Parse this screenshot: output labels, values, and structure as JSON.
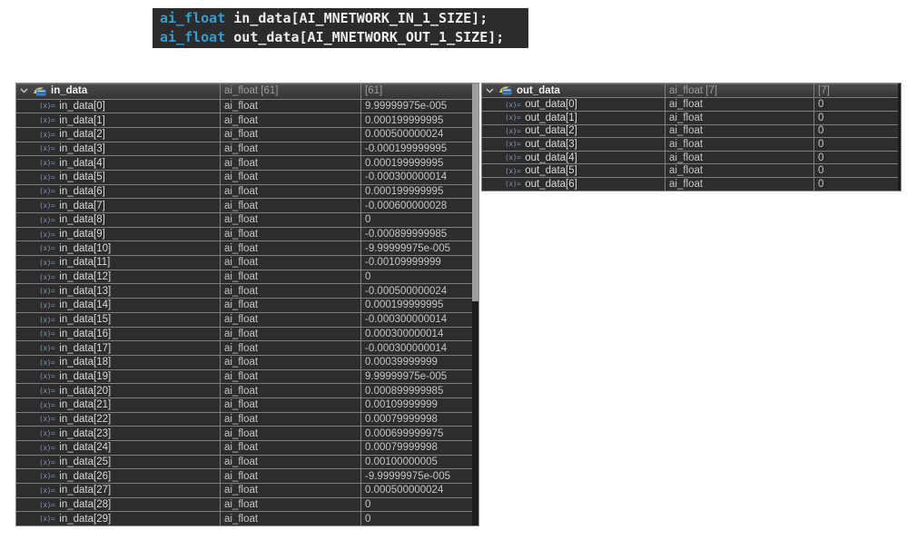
{
  "code": {
    "lines": [
      {
        "keyword": "ai_float",
        "rest": " in_data[AI_MNETWORK_IN_1_SIZE];"
      },
      {
        "keyword": "ai_float",
        "rest": " out_data[AI_MNETWORK_OUT_1_SIZE];"
      }
    ],
    "keyword_color": "#2f9fd6",
    "background_color": "#2b2b2b"
  },
  "icons": {
    "chevron_expanded": "chevron-down",
    "variable_glyph": "(x)=",
    "array_icon_blue": "#3f7fc1",
    "array_icon_yellow": "#e8c44a"
  },
  "tables": [
    {
      "id": "in_data",
      "header": {
        "name": "in_data",
        "type": "ai_float [61]",
        "value": "[61]"
      },
      "rows": [
        {
          "name": "in_data[0]",
          "type": "ai_float",
          "value": "9.99999975e-005"
        },
        {
          "name": "in_data[1]",
          "type": "ai_float",
          "value": "0.000199999995"
        },
        {
          "name": "in_data[2]",
          "type": "ai_float",
          "value": "0.000500000024"
        },
        {
          "name": "in_data[3]",
          "type": "ai_float",
          "value": "-0.000199999995"
        },
        {
          "name": "in_data[4]",
          "type": "ai_float",
          "value": "0.000199999995"
        },
        {
          "name": "in_data[5]",
          "type": "ai_float",
          "value": "-0.000300000014"
        },
        {
          "name": "in_data[6]",
          "type": "ai_float",
          "value": "0.000199999995"
        },
        {
          "name": "in_data[7]",
          "type": "ai_float",
          "value": "-0.000600000028"
        },
        {
          "name": "in_data[8]",
          "type": "ai_float",
          "value": "0"
        },
        {
          "name": "in_data[9]",
          "type": "ai_float",
          "value": "-0.000899999985"
        },
        {
          "name": "in_data[10]",
          "type": "ai_float",
          "value": "-9.99999975e-005"
        },
        {
          "name": "in_data[11]",
          "type": "ai_float",
          "value": "-0.00109999999"
        },
        {
          "name": "in_data[12]",
          "type": "ai_float",
          "value": "0"
        },
        {
          "name": "in_data[13]",
          "type": "ai_float",
          "value": "-0.000500000024"
        },
        {
          "name": "in_data[14]",
          "type": "ai_float",
          "value": "0.000199999995"
        },
        {
          "name": "in_data[15]",
          "type": "ai_float",
          "value": "-0.000300000014"
        },
        {
          "name": "in_data[16]",
          "type": "ai_float",
          "value": "0.000300000014"
        },
        {
          "name": "in_data[17]",
          "type": "ai_float",
          "value": "-0.000300000014"
        },
        {
          "name": "in_data[18]",
          "type": "ai_float",
          "value": "0.00039999999"
        },
        {
          "name": "in_data[19]",
          "type": "ai_float",
          "value": "9.99999975e-005"
        },
        {
          "name": "in_data[20]",
          "type": "ai_float",
          "value": "0.000899999985"
        },
        {
          "name": "in_data[21]",
          "type": "ai_float",
          "value": "0.00109999999"
        },
        {
          "name": "in_data[22]",
          "type": "ai_float",
          "value": "0.00079999998"
        },
        {
          "name": "in_data[23]",
          "type": "ai_float",
          "value": "0.000699999975"
        },
        {
          "name": "in_data[24]",
          "type": "ai_float",
          "value": "0.00079999998"
        },
        {
          "name": "in_data[25]",
          "type": "ai_float",
          "value": "0.00100000005"
        },
        {
          "name": "in_data[26]",
          "type": "ai_float",
          "value": "-9.99999975e-005"
        },
        {
          "name": "in_data[27]",
          "type": "ai_float",
          "value": "0.000500000024"
        },
        {
          "name": "in_data[28]",
          "type": "ai_float",
          "value": "0"
        },
        {
          "name": "in_data[29]",
          "type": "ai_float",
          "value": "0"
        }
      ]
    },
    {
      "id": "out_data",
      "header": {
        "name": "out_data",
        "type": "ai_float [7]",
        "value": "[7]"
      },
      "rows": [
        {
          "name": "out_data[0]",
          "type": "ai_float",
          "value": "0"
        },
        {
          "name": "out_data[1]",
          "type": "ai_float",
          "value": "0"
        },
        {
          "name": "out_data[2]",
          "type": "ai_float",
          "value": "0"
        },
        {
          "name": "out_data[3]",
          "type": "ai_float",
          "value": "0"
        },
        {
          "name": "out_data[4]",
          "type": "ai_float",
          "value": "0"
        },
        {
          "name": "out_data[5]",
          "type": "ai_float",
          "value": "0"
        },
        {
          "name": "out_data[6]",
          "type": "ai_float",
          "value": "0"
        }
      ]
    }
  ]
}
